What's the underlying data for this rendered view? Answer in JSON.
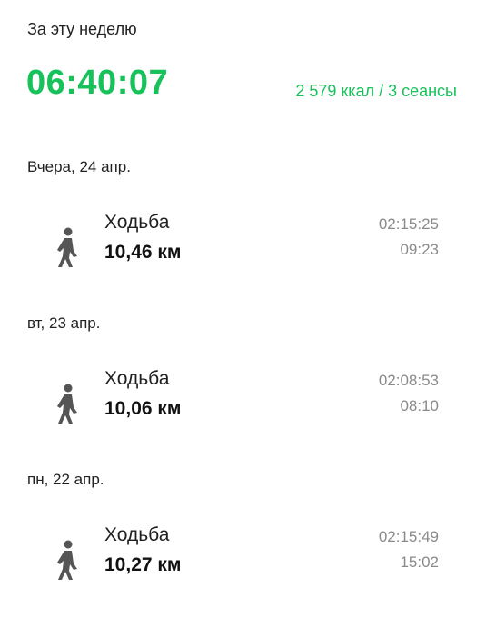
{
  "week": {
    "label": "За эту неделю",
    "total_time": "06:40:07",
    "summary": "2 579 ккал / 3 сеансы"
  },
  "days": [
    {
      "header": "Вчера, 24 апр.",
      "activity": {
        "icon": "walking-person-icon",
        "name": "Ходьба",
        "distance": "10,46 км",
        "duration": "02:15:25",
        "pace": "09:23"
      }
    },
    {
      "header": "вт, 23 апр.",
      "activity": {
        "icon": "walking-person-icon",
        "name": "Ходьба",
        "distance": "10,06 км",
        "duration": "02:08:53",
        "pace": "08:10"
      }
    },
    {
      "header": "пн, 22 апр.",
      "activity": {
        "icon": "walking-person-icon",
        "name": "Ходьба",
        "distance": "10,27 км",
        "duration": "02:15:49",
        "pace": "15:02"
      }
    }
  ],
  "colors": {
    "accent": "#17c25a",
    "secondary_text": "#8a8a8a",
    "icon": "#555555"
  }
}
